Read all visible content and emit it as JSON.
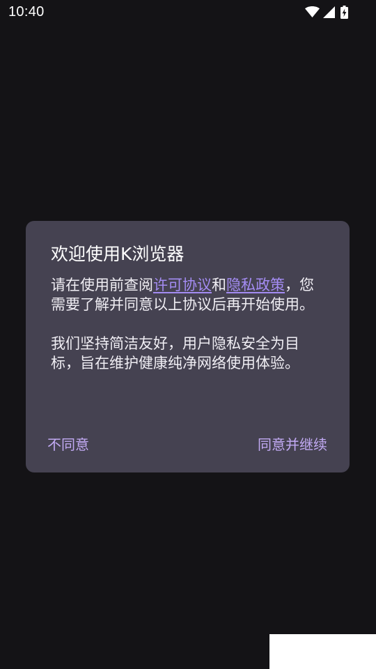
{
  "status_bar": {
    "time": "10:40",
    "icons": [
      "wifi-icon",
      "signal-icon",
      "battery-charging-icon"
    ]
  },
  "dialog": {
    "title": "欢迎使用K浏览器",
    "body": {
      "para1_before": "请在使用前查阅",
      "license_link": "许可协议",
      "and": "和",
      "privacy_link": "隐私政策",
      "para1_after": "，您需要了解并同意以上协议后再开始使用。",
      "para2": "我们坚持简洁友好，用户隐私安全为目标，旨在维护健康纯净网络使用体验。"
    },
    "buttons": {
      "disagree": "不同意",
      "agree": "同意并继续"
    }
  },
  "colors": {
    "background": "#141316",
    "dialog_bg": "#454251",
    "link": "#a48cf3",
    "button_text": "#c2aaf4"
  }
}
